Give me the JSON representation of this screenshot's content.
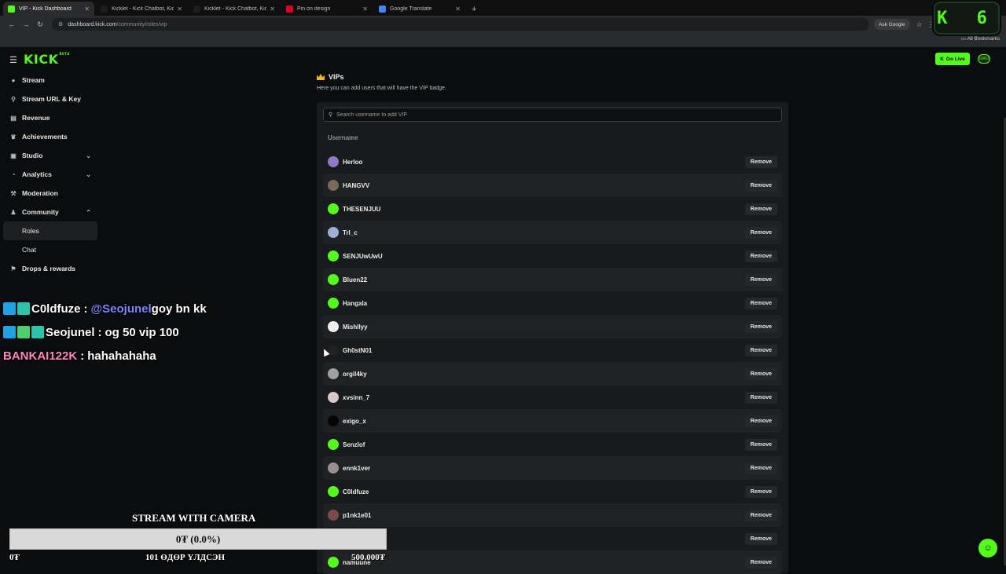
{
  "browser": {
    "tabs": [
      {
        "title": "VIP - Kick Dashboard",
        "active": true,
        "favicon_color": "#53fc18"
      },
      {
        "title": "Kicklet - Kick Chatbot, Kick Wid...",
        "active": false,
        "favicon_color": "#1d1d1d"
      },
      {
        "title": "Kicklet - Kick Chatbot, Kick Wid...",
        "active": false,
        "favicon_color": "#1d1d1d"
      },
      {
        "title": "Pin on design",
        "active": false,
        "favicon_color": "#e60023"
      },
      {
        "title": "Google Translate",
        "active": false,
        "favicon_color": "#4285f4"
      }
    ],
    "new_tab": "+",
    "url_host": "dashboard.kick.com",
    "url_path": "/community/roles/vip",
    "ask_google": "Ask Google",
    "all_bookmarks": "All Bookmarks"
  },
  "overlay_counter": "K 6",
  "app": {
    "logo": "KICK",
    "logo_beta": "BETA",
    "go_live": "Go Live",
    "avatar_text": "GWO",
    "sidebar": [
      {
        "label": "Stream",
        "icon": "●",
        "chevron": ""
      },
      {
        "label": "Stream URL & Key",
        "icon": "⚲",
        "chevron": ""
      },
      {
        "label": "Revenue",
        "icon": "▤",
        "chevron": ""
      },
      {
        "label": "Achievements",
        "icon": "♛",
        "chevron": ""
      },
      {
        "label": "Studio",
        "icon": "▣",
        "chevron": "⌄"
      },
      {
        "label": "Analytics",
        "icon": "◔",
        "chevron": "⌄"
      },
      {
        "label": "Moderation",
        "icon": "⚒",
        "chevron": ""
      },
      {
        "label": "Community",
        "icon": "♟",
        "chevron": "⌃"
      },
      {
        "label": "Roles",
        "icon": "",
        "chevron": ""
      },
      {
        "label": "Chat",
        "icon": "",
        "chevron": ""
      },
      {
        "label": "Drops & rewards",
        "icon": "⚑",
        "chevron": ""
      }
    ],
    "page_title": "VIPs",
    "page_desc": "Here you can add users that will have the VIP badge.",
    "search_placeholder": "Search username to add VIP",
    "column_username": "Username",
    "remove_label": "Remove",
    "users": [
      {
        "name": "Herloo",
        "avatar_color": "#8e7ac9"
      },
      {
        "name": "HANGVV",
        "avatar_color": "#7a6a5a"
      },
      {
        "name": "THESENJUU",
        "avatar_color": "#53fc18"
      },
      {
        "name": "Trl_c",
        "avatar_color": "#9ab0d6"
      },
      {
        "name": "SENJUwUwU",
        "avatar_color": "#53fc18"
      },
      {
        "name": "Bluen22",
        "avatar_color": "#53fc18"
      },
      {
        "name": "Hangala",
        "avatar_color": "#53fc18"
      },
      {
        "name": "Mishllyy",
        "avatar_color": "#eeeeee"
      },
      {
        "name": "Gh0stN01",
        "avatar_color": "#222222"
      },
      {
        "name": "orgil4ky",
        "avatar_color": "#a0a0a0"
      },
      {
        "name": "xvsinn_7",
        "avatar_color": "#d8c7c7"
      },
      {
        "name": "exigo_x",
        "avatar_color": "#050505"
      },
      {
        "name": "Senzlof",
        "avatar_color": "#53fc18"
      },
      {
        "name": "ennk1ver",
        "avatar_color": "#9a8f8f"
      },
      {
        "name": "C0ldfuze",
        "avatar_color": "#53fc18"
      },
      {
        "name": "p1nk1e01",
        "avatar_color": "#7b4a4a"
      },
      {
        "name": "",
        "avatar_color": "#1f2123"
      },
      {
        "name": "namuune",
        "avatar_color": "#53fc18"
      }
    ]
  },
  "chat": [
    {
      "user": "C0ldfuze",
      "mention": "@Seojunel",
      "message": " goy bn kk",
      "user_color": "#ffffff",
      "badges": [
        "b-blue",
        "b-teal"
      ]
    },
    {
      "user": "Seojunel",
      "mention": "",
      "message": " og 50 vip 100",
      "user_color": "#ffffff",
      "badges": [
        "b-blue",
        "b-green",
        "b-teal"
      ]
    },
    {
      "user": "BANKAI122K",
      "mention": "",
      "message": " hahahahaha",
      "user_color": "#ff87b6",
      "badges": []
    }
  ],
  "chat_separator": ":",
  "goal": {
    "title": "STREAM WITH CAMERA",
    "percent_text": "0₮ (0.0%)",
    "progress_fraction": 0.0,
    "min_text": "0₮",
    "days_text": "101 ӨДӨР ҮЛДСЭН",
    "max_text": "500.000₮"
  }
}
